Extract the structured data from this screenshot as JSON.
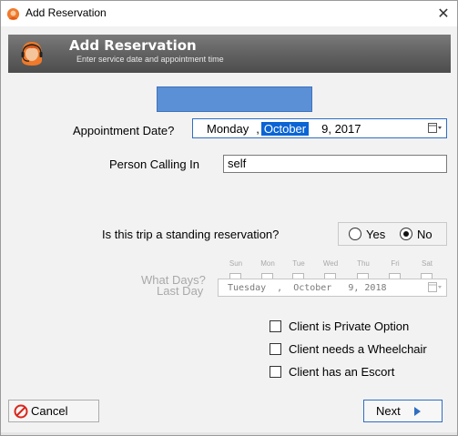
{
  "window": {
    "title": "Add Reservation",
    "close_glyph": "✕"
  },
  "banner": {
    "title": "Add Reservation",
    "subtitle": "Enter service date and appointment time"
  },
  "appointment": {
    "label": "Appointment Date?",
    "weekday": "Monday",
    "sep": ",",
    "month": "October",
    "day_year": "9, 2017"
  },
  "caller": {
    "label": "Person Calling In",
    "value": "self"
  },
  "standing": {
    "question": "Is this trip a standing reservation?",
    "yes": "Yes",
    "no": "No",
    "selected": "No"
  },
  "days": {
    "label": "What Days?",
    "names": [
      "Sun",
      "Mon",
      "Tue",
      "Wed",
      "Thu",
      "Fri",
      "Sat"
    ]
  },
  "last_day": {
    "label": "Last Day",
    "weekday": "Tuesday",
    "sep1": ",",
    "month": "October",
    "day_year": "9, 2018"
  },
  "options": [
    {
      "label": "Client is Private Option",
      "checked": false
    },
    {
      "label": "Client needs a Wheelchair",
      "checked": false
    },
    {
      "label": "Client has an Escort",
      "checked": false
    }
  ],
  "buttons": {
    "cancel": "Cancel",
    "next": "Next"
  },
  "colors": {
    "accent": "#0a64d4",
    "cancel_icon": "#d9261c",
    "banner": "#5f5f5f"
  },
  "icons": {
    "app": "headset-agent-icon",
    "calendar": "calendar-dropdown-icon",
    "cancel": "no-entry-icon",
    "next": "play-arrow-icon"
  }
}
